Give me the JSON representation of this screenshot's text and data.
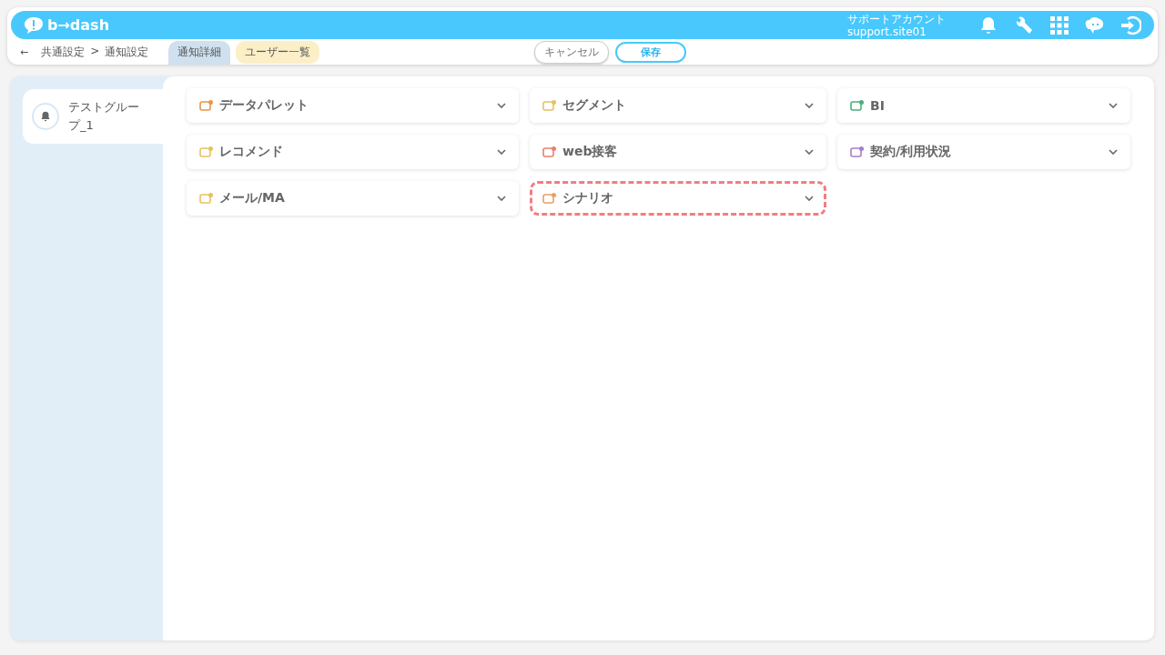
{
  "header": {
    "logo": "b→dash",
    "account_label": "サポートアカウント",
    "account_id": "support.site01"
  },
  "toolbar": {
    "back": "←",
    "breadcrumb": [
      "共通設定",
      "通知設定"
    ],
    "separator": ">",
    "tabs": [
      {
        "label": "通知詳細",
        "selected": true
      },
      {
        "label": "ユーザー一覧",
        "selected": false
      }
    ],
    "cancel": "キャンセル",
    "save": "保存"
  },
  "sidebar": {
    "items": [
      {
        "label": "テストグループ_1",
        "selected": true
      }
    ]
  },
  "categories": [
    {
      "label": "データパレット",
      "color": "#e8954a",
      "highlighted": false
    },
    {
      "label": "セグメント",
      "color": "#e8c060",
      "highlighted": false
    },
    {
      "label": "BI",
      "color": "#4caf7a",
      "highlighted": false
    },
    {
      "label": "レコメンド",
      "color": "#e8c060",
      "highlighted": false
    },
    {
      "label": "web接客",
      "color": "#e8806a",
      "highlighted": false
    },
    {
      "label": "契約/利用状況",
      "color": "#a77cc8",
      "highlighted": false
    },
    {
      "label": "メール/MA",
      "color": "#e8c060",
      "highlighted": false
    },
    {
      "label": "シナリオ",
      "color": "#e8a060",
      "highlighted": true
    }
  ]
}
